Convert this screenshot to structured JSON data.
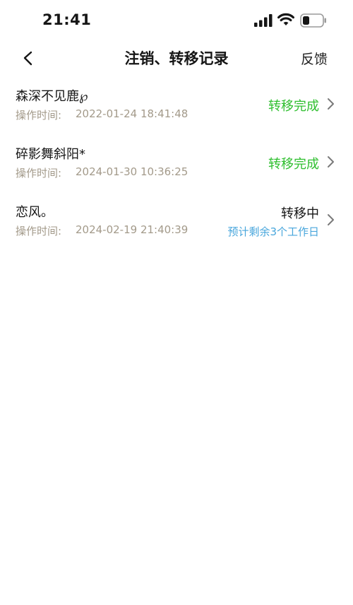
{
  "status_bar": {
    "time": "21:41"
  },
  "nav": {
    "title": "注销、转移记录",
    "feedback": "反馈"
  },
  "records": [
    {
      "name": "森深不见鹿℘",
      "time_label": "操作时间:",
      "time_value": "2022-01-24 18:41:48",
      "status": "转移完成"
    },
    {
      "name": "碎影舞斜阳*",
      "time_label": "操作时间:",
      "time_value": "2024-01-30 10:36:25",
      "status": "转移完成"
    },
    {
      "name": "恋风。",
      "time_label": "操作时间:",
      "time_value": "2024-02-19 21:40:39",
      "status": "转移中",
      "substatus": "预计剩余3个工作日"
    }
  ],
  "colors": {
    "done": "#2fbf2f",
    "pending_hint": "#48a6dc",
    "muted": "#a39a8a"
  }
}
